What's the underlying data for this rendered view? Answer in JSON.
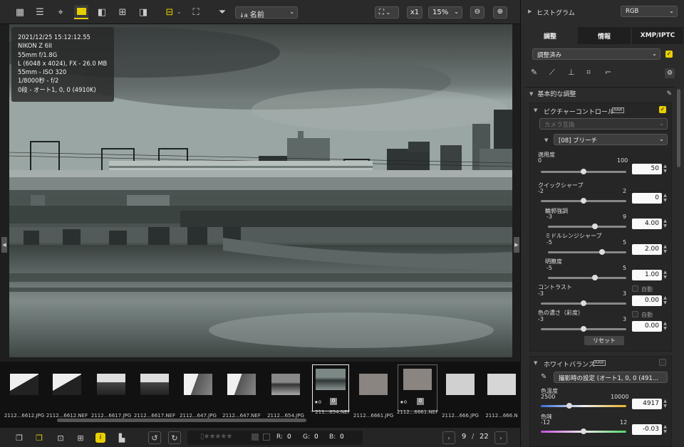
{
  "toolbar": {
    "sort_label": "名前",
    "zoom_multiplier": "x1",
    "zoom_level": "15%"
  },
  "photo_info": {
    "line1": "2021/12/25 15:12:12.55",
    "line2": "NIKON Z 6II",
    "line3": "55mm f/1.8G",
    "line4": "L (6048 x 4024), FX - 26.0 MB",
    "line5": "55mm - ISO 320",
    "line6": "1/8000秒 - f/2",
    "line7": "0段 - オート1, 0, 0 (4910K)"
  },
  "filmstrip": [
    {
      "caption": "2112...6612.JPG"
    },
    {
      "caption": "2112...6612.NEF"
    },
    {
      "caption": "2112...6617.JPG"
    },
    {
      "caption": "2112...6617.NEF"
    },
    {
      "caption": "2112...647.JPG"
    },
    {
      "caption": "2112...647.NEF"
    },
    {
      "caption": "2112...654.JPG"
    },
    {
      "caption": "* 211...654.NEF",
      "rating": "★0",
      "badge": "0"
    },
    {
      "caption": "2112...6661.JPG"
    },
    {
      "caption": "2112...6661.NEF",
      "rating": "★0",
      "badge": "0"
    },
    {
      "caption": "2112...666.JPG"
    },
    {
      "caption": "2112...666.N"
    }
  ],
  "bottombar": {
    "r_label": "R:",
    "r_value": "0",
    "g_label": "G:",
    "g_value": "0",
    "b_label": "B:",
    "b_value": "0",
    "page_current": "9",
    "page_sep": "/",
    "page_total": "22"
  },
  "panel": {
    "histogram_label": "ヒストグラム",
    "histogram_mode": "RGB",
    "tabs": [
      "調整",
      "情報",
      "XMP/IPTC"
    ],
    "preset": "調整済み",
    "basic_adjust": "基本的な調整",
    "picture_control": {
      "title": "ピクチャーコントロール",
      "raw_tag": "RAW",
      "compat": "カメラ互換",
      "mode": "[08] ブリーチ",
      "apply_label": "適用度",
      "apply_min": "0",
      "apply_max": "100",
      "apply_value": "50",
      "quick_label": "クイックシャープ",
      "quick_min": "-2",
      "quick_max": "2",
      "quick_value": "0",
      "outline_label": "輪郭強調",
      "outline_min": "-3",
      "outline_max": "9",
      "outline_value": "4.00",
      "mid_label": "ミドルレンジシャープ",
      "mid_min": "-5",
      "mid_max": "5",
      "mid_value": "2.00",
      "clarity_label": "明瞭度",
      "clarity_min": "-5",
      "clarity_max": "5",
      "clarity_value": "1.00",
      "contrast_label": "コントラスト",
      "contrast_min": "-3",
      "contrast_max": "3",
      "contrast_value": "0.00",
      "saturation_label": "色の濃さ（彩度）",
      "saturation_min": "-3",
      "saturation_max": "3",
      "saturation_value": "0.00",
      "auto_label": "自動",
      "reset_label": "リセット"
    },
    "white_balance": {
      "title": "ホワイトバランス",
      "raw_tag": "RAW",
      "setting": "撮影時の設定 (オート1, 0, 0 (491...",
      "temp_label": "色温度",
      "temp_min": "2500",
      "temp_max": "10000",
      "temp_value": "4917",
      "tint_label": "色味",
      "tint_min": "-12",
      "tint_max": "12",
      "tint_value": "-0.03"
    }
  }
}
